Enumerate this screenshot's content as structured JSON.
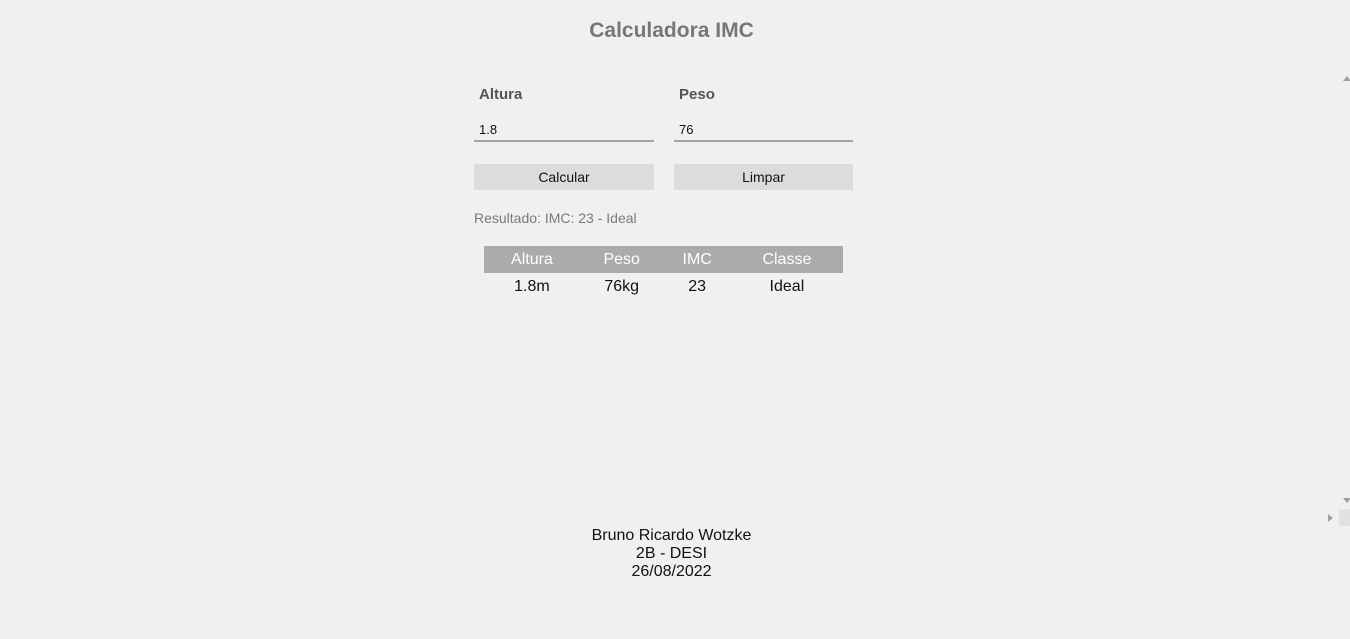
{
  "page": {
    "title": "Calculadora IMC"
  },
  "form": {
    "altura_label": "Altura",
    "altura_value": "1.8",
    "peso_label": "Peso",
    "peso_value": "76",
    "calcular_label": "Calcular",
    "limpar_label": "Limpar"
  },
  "result": {
    "text": "Resultado: IMC: 23 - Ideal"
  },
  "table": {
    "headers": [
      "Altura",
      "Peso",
      "IMC",
      "Classe"
    ],
    "rows": [
      [
        "1.8m",
        "76kg",
        "23",
        "Ideal"
      ]
    ]
  },
  "footer": {
    "name": "Bruno Ricardo Wotzke",
    "class": "2B - DESI",
    "date": "26/08/2022"
  },
  "colors": {
    "background": "#f0f0f0",
    "title": "#777777",
    "table_header_bg": "#ababab",
    "button_bg": "#dcdcdc"
  }
}
